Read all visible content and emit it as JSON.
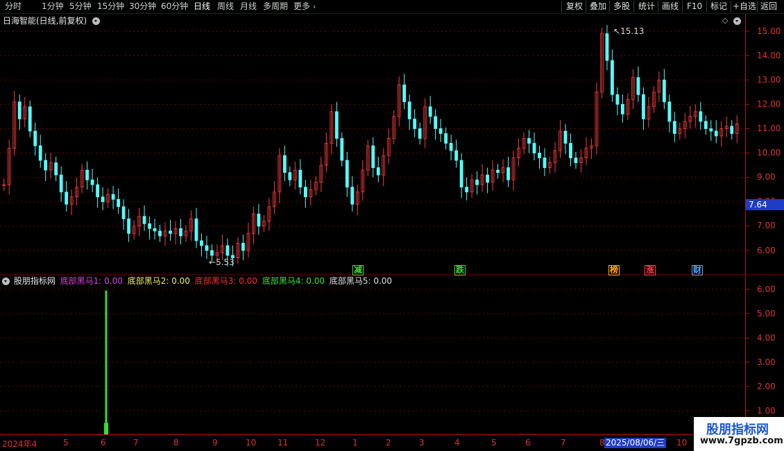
{
  "toolbar": {
    "left_items": [
      "分时",
      "1分钟",
      "5分钟",
      "15分钟",
      "30分钟",
      "60分钟",
      "日线",
      "周线",
      "月线",
      "多周期",
      "更多"
    ],
    "more_icon": "chevron-right-icon",
    "active": "日线",
    "right_items": [
      "复权",
      "叠加",
      "多股",
      "统计",
      "画线",
      "F10",
      "标记",
      "+自选",
      "返回"
    ]
  },
  "main_chart": {
    "title": "日海智能(日线,前复权)",
    "dropdown_icon": "chevron-down-circle-icon",
    "diamond_icon": "diamond-icon",
    "y_ticks": [
      "15.00",
      "14.00",
      "13.00",
      "12.00",
      "11.00",
      "10.00",
      "9.00",
      "8.00",
      "7.00",
      "6.00"
    ],
    "current_price": "7.64",
    "high_marker": "15.13",
    "low_marker": "5.53",
    "event_marks": [
      {
        "text": "减",
        "color": "#3ddc3d"
      },
      {
        "text": "跌",
        "color": "#3ddc3d"
      },
      {
        "text": "榜",
        "color": "#ffb000"
      },
      {
        "text": "涨",
        "color": "#ff4040"
      },
      {
        "text": "财",
        "color": "#4aa8ff"
      }
    ]
  },
  "indicator": {
    "name": "股朋指标网",
    "dropdown_icon": "chevron-down-circle-icon",
    "series": [
      {
        "label": "底部黑马1: 0.00",
        "color": "#e040e0"
      },
      {
        "label": "底部黑马2: 0.00",
        "color": "#f0f060"
      },
      {
        "label": "底部黑马3: 0.00",
        "color": "#ff3030"
      },
      {
        "label": "底部黑马4: 0.00",
        "color": "#40e040"
      },
      {
        "label": "底部黑马5: 0.00",
        "color": "#e0e0e0"
      }
    ],
    "y_ticks": [
      "6.00",
      "5.00",
      "4.00",
      "3.00",
      "2.00",
      "1.00"
    ]
  },
  "x_axis": {
    "labels": [
      "2024年4",
      "5",
      "6",
      "7",
      "8",
      "9",
      "10",
      "11",
      "12",
      "1",
      "2",
      "3",
      "4",
      "5",
      "6",
      "7",
      "8"
    ],
    "cursor_date": "2025/08/06/三",
    "trailing_label": "10"
  },
  "watermark": {
    "title": "股朋指标网",
    "url": "www.7gpzb.com"
  },
  "colors": {
    "up": "#ff3c3c",
    "down": "#54ffff",
    "axis": "#c01010",
    "grid": "#7a0000",
    "signal": "#30e030"
  },
  "chart_data": {
    "type": "candlestick",
    "y_range": [
      5.0,
      15.5
    ],
    "closes": [
      8.7,
      10.2,
      12.1,
      11.4,
      11.9,
      10.9,
      10.3,
      9.7,
      9.3,
      9.6,
      9.1,
      8.4,
      7.9,
      8.2,
      8.6,
      9.3,
      8.9,
      8.7,
      8.2,
      8.0,
      8.3,
      8.1,
      7.8,
      7.3,
      6.7,
      7.0,
      7.4,
      7.1,
      6.9,
      6.8,
      6.6,
      6.8,
      6.7,
      6.9,
      6.6,
      6.8,
      7.3,
      6.4,
      6.2,
      6.0,
      5.8,
      5.9,
      6.2,
      5.8,
      5.7,
      6.3,
      6.0,
      6.7,
      7.5,
      7.0,
      7.2,
      7.8,
      8.4,
      9.9,
      9.2,
      8.9,
      9.3,
      8.6,
      8.2,
      8.5,
      8.8,
      9.5,
      10.4,
      11.7,
      10.6,
      9.7,
      8.6,
      7.9,
      8.4,
      9.3,
      10.3,
      9.4,
      9.1,
      9.9,
      10.6,
      11.5,
      12.8,
      12.1,
      11.4,
      11.0,
      10.6,
      11.9,
      11.5,
      11.0,
      10.8,
      10.4,
      10.1,
      9.7,
      8.6,
      8.4,
      8.9,
      8.7,
      9.1,
      8.8,
      9.3,
      9.2,
      9.4,
      8.9,
      9.8,
      10.2,
      10.6,
      10.4,
      10.0,
      9.8,
      9.4,
      9.6,
      10.1,
      10.9,
      10.4,
      9.8,
      9.6,
      9.8,
      10.2,
      10.3,
      12.5,
      14.9,
      13.8,
      12.4,
      12.0,
      11.6,
      12.2,
      13.1,
      12.4,
      11.4,
      11.9,
      12.5,
      13.0,
      12.1,
      11.3,
      10.8,
      11.0,
      11.3,
      11.5,
      11.7,
      11.3,
      11.0,
      10.9,
      10.7,
      11.0,
      11.1,
      10.8,
      11.2
    ]
  }
}
